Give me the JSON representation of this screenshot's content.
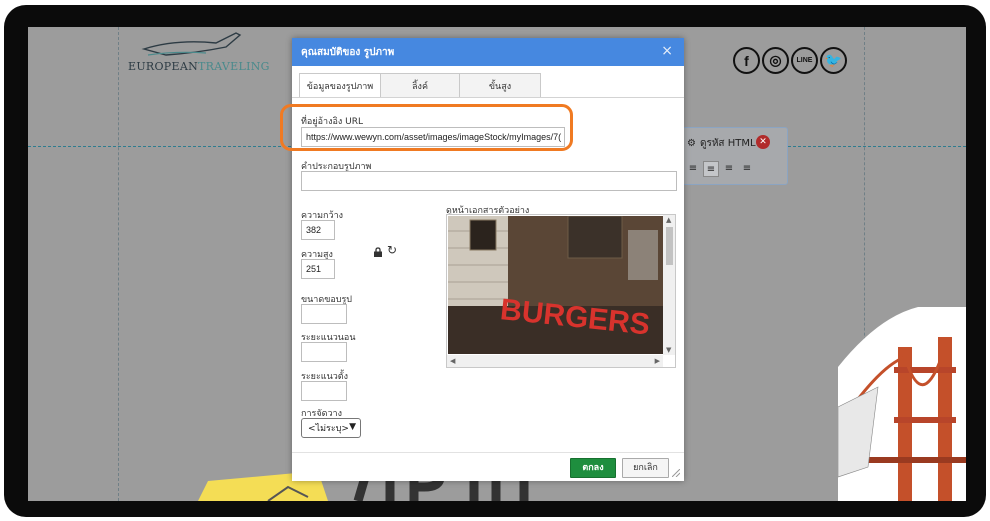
{
  "website": {
    "logo": {
      "text_left": "EUROPEAN",
      "text_right": "TRAVELING"
    },
    "social_icons": [
      {
        "icon": "facebook-icon",
        "glyph": "f"
      },
      {
        "icon": "instagram-icon",
        "glyph": "◎"
      },
      {
        "icon": "line-icon",
        "glyph": "LINE"
      },
      {
        "icon": "twitter-icon",
        "glyph": "🐦"
      }
    ],
    "edit_toolbar": {
      "html_button_label": "ดูรหัส HTML"
    }
  },
  "dialog": {
    "title": "คุณสมบัติของ รูปภาพ",
    "close_glyph": "×",
    "tabs": [
      {
        "label": "ข้อมูลของรูปภาพ",
        "active": true
      },
      {
        "label": "ลิ้งค์",
        "active": false
      },
      {
        "label": "ขั้นสูง",
        "active": false
      }
    ],
    "url": {
      "label": "ที่อยู่อ้างอิง URL",
      "value": "https://www.wewyn.com/asset/images/imageStock/myImages/7("
    },
    "alt_text": {
      "label": "คำประกอบรูปภาพ",
      "value": ""
    },
    "width": {
      "label": "ความกว้าง",
      "value": "382"
    },
    "height": {
      "label": "ความสูง",
      "value": "251"
    },
    "border": {
      "label": "ขนาดขอบรูป",
      "value": ""
    },
    "hspace": {
      "label": "ระยะแนวนอน",
      "value": ""
    },
    "vspace": {
      "label": "ระยะแนวตั้ง",
      "value": ""
    },
    "align": {
      "label": "การจัดวาง",
      "selected": "<ไม่ระบุ>"
    },
    "preview": {
      "label": "ดูหน้าเอกสารตัวอย่าง",
      "image_text": "BURGERS"
    },
    "ok_label": "ตกลง",
    "cancel_label": "ยกเลิก"
  },
  "colors": {
    "dialog_header": "#4688e0",
    "ok_button": "#1e8e3e",
    "highlight": "#f07a22",
    "overlay": "#9c9c9c"
  }
}
